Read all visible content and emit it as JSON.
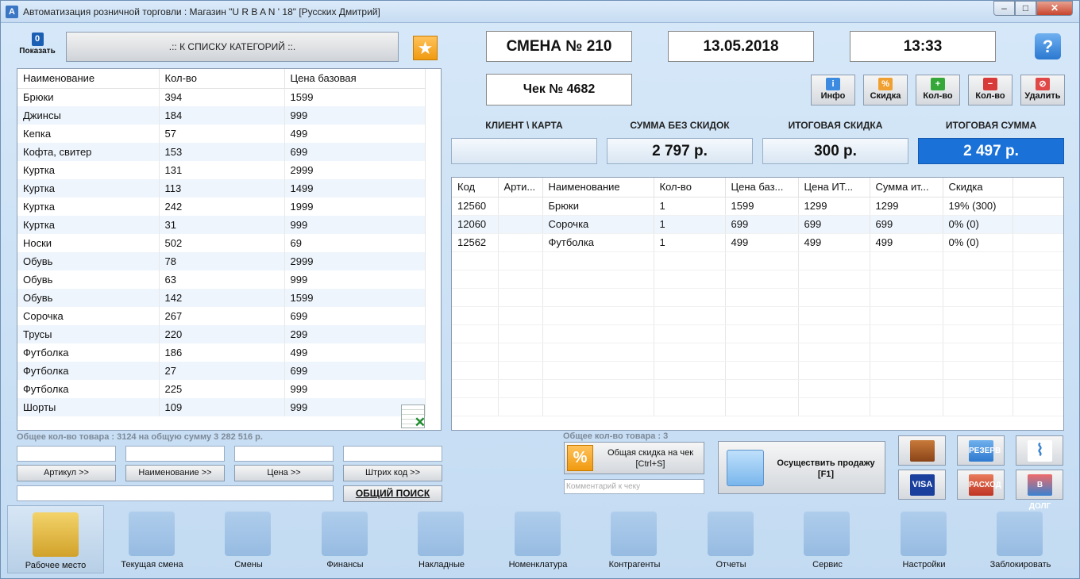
{
  "window": {
    "title": "Автоматизация розничной торговли : Магазин \"U R B A N ' 18\" [Русских Дмитрий]"
  },
  "left": {
    "show_label": "Показать",
    "show_count": "0",
    "category_button": ".:: К СПИСКУ КАТЕГОРИЙ ::.",
    "columns": [
      "Наименование",
      "Кол-во",
      "Цена базовая"
    ],
    "rows": [
      [
        "Брюки",
        "394",
        "1599"
      ],
      [
        "Джинсы",
        "184",
        "999"
      ],
      [
        "Кепка",
        "57",
        "499"
      ],
      [
        "Кофта, свитер",
        "153",
        "699"
      ],
      [
        "Куртка",
        "131",
        "2999"
      ],
      [
        "Куртка",
        "113",
        "1499"
      ],
      [
        "Куртка",
        "242",
        "1999"
      ],
      [
        "Куртка",
        "31",
        "999"
      ],
      [
        "Носки",
        "502",
        "69"
      ],
      [
        "Обувь",
        "78",
        "2999"
      ],
      [
        "Обувь",
        "63",
        "999"
      ],
      [
        "Обувь",
        "142",
        "1599"
      ],
      [
        "Сорочка",
        "267",
        "699"
      ],
      [
        "Трусы",
        "220",
        "299"
      ],
      [
        "Футболка",
        "186",
        "499"
      ],
      [
        "Футболка",
        "27",
        "699"
      ],
      [
        "Футболка",
        "225",
        "999"
      ],
      [
        "Шорты",
        "109",
        "999"
      ]
    ],
    "summary": "Общее кол-во товара : 3124 на общую сумму 3 282 516 р.",
    "filters": {
      "article": "Артикул >>",
      "name": "Наименование >>",
      "price": "Цена >>",
      "barcode": "Штрих код >>",
      "search": "ОБЩИЙ ПОИСК"
    }
  },
  "header": {
    "shift": "СМЕНА № 210",
    "date": "13.05.2018",
    "time": "13:33",
    "receipt": "Чек № 4682"
  },
  "toolbar": {
    "info": "Инфо",
    "discount": "Скидка",
    "qty_plus": "Кол-во",
    "qty_minus": "Кол-во",
    "delete": "Удалить"
  },
  "totals": {
    "client_label": "КЛИЕНТ \\ КАРТА",
    "client_value": "",
    "no_discount_label": "СУММА БЕЗ СКИДОК",
    "no_discount_value": "2 797 р.",
    "discount_label": "ИТОГОВАЯ СКИДКА",
    "discount_value": "300 р.",
    "total_label": "ИТОГОВАЯ СУММА",
    "total_value": "2 497 р."
  },
  "receipt_table": {
    "columns": [
      "Код",
      "Арти...",
      "Наименование",
      "Кол-во",
      "Цена баз...",
      "Цена ИТ...",
      "Сумма ит...",
      "Скидка"
    ],
    "rows": [
      [
        "12560",
        "",
        "Брюки",
        "1",
        "1599",
        "1299",
        "1299",
        "19% (300)"
      ],
      [
        "12060",
        "",
        "Сорочка",
        "1",
        "699",
        "699",
        "699",
        "0% (0)"
      ],
      [
        "12562",
        "",
        "Футболка",
        "1",
        "499",
        "499",
        "499",
        "0% (0)"
      ]
    ]
  },
  "bottom": {
    "receipt_count": "Общее кол-во товара : 3",
    "total_discount_btn": "Общая скидка на чек",
    "total_discount_hotkey": "[Ctrl+S]",
    "comment_placeholder": "Комментарий к чеку",
    "sell_btn": "Осуществить продажу",
    "sell_hotkey": "[F1]",
    "visa_label": "VISA",
    "pay_labels": [
      "РЕЗЕРВ",
      "РАСХОД",
      "В ДОЛГ"
    ]
  },
  "nav": [
    "Рабочее место",
    "Текущая смена",
    "Смены",
    "Финансы",
    "Накладные",
    "Номенклатура",
    "Контрагенты",
    "Отчеты",
    "Сервис",
    "Настройки",
    "Заблокировать"
  ],
  "colors": {
    "accent": "#1a72d9",
    "star": "#f09a10"
  }
}
